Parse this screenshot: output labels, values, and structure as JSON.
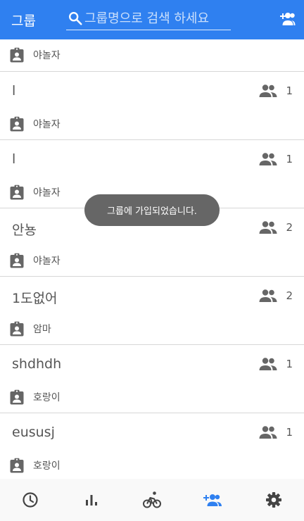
{
  "header": {
    "title": "그룹",
    "search_placeholder": "그룹명으로 검색 하세요",
    "add_group_icon": "group-add-icon"
  },
  "colors": {
    "primary": "#2f80f0",
    "icon_gray": "#666666",
    "text_gray": "#555555",
    "toast_bg": "#666666"
  },
  "groups": [
    {
      "name": "",
      "member_count": "",
      "owner": "야놀자"
    },
    {
      "name": "l",
      "member_count": "1",
      "owner": "야놀자"
    },
    {
      "name": "l",
      "member_count": "1",
      "owner": "야놀자"
    },
    {
      "name": "안뇽",
      "member_count": "2",
      "owner": "야놀자"
    },
    {
      "name": "1도없어",
      "member_count": "2",
      "owner": "암마"
    },
    {
      "name": "shdhdh",
      "member_count": "1",
      "owner": "호랑이"
    },
    {
      "name": "eususj",
      "member_count": "1",
      "owner": "호랑이"
    }
  ],
  "toast": {
    "message": "그룹에 가입되었습니다."
  },
  "bottom_nav": {
    "active_index": 3,
    "tabs": [
      {
        "icon": "history-clock-icon"
      },
      {
        "icon": "bar-chart-icon"
      },
      {
        "icon": "cycling-icon"
      },
      {
        "icon": "group-add-icon"
      },
      {
        "icon": "settings-gear-icon"
      }
    ]
  }
}
